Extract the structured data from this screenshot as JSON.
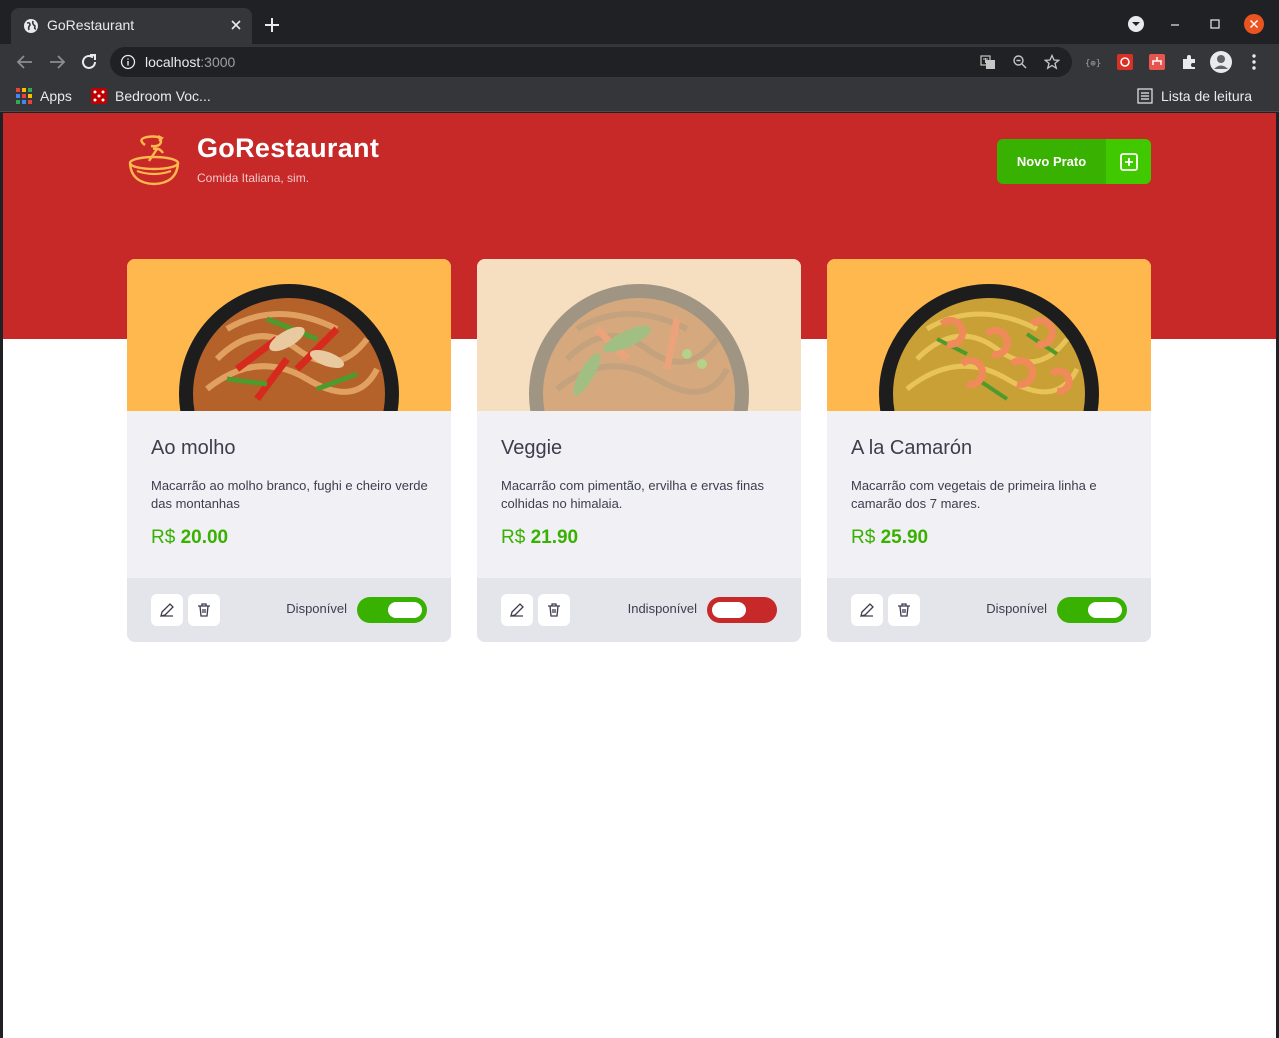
{
  "browser": {
    "tab_title": "GoRestaurant",
    "url_host": "localhost",
    "url_port": ":3000",
    "bookmarks": [
      {
        "label": "Apps",
        "icon": "apps-grid-icon"
      },
      {
        "label": "Bedroom Voc...",
        "icon": "bedroom-voc-icon"
      }
    ],
    "reading_list_label": "Lista de leitura"
  },
  "header": {
    "brand": "GoRestaurant",
    "tagline": "Comida Italiana, sim.",
    "new_button_label": "Novo Prato"
  },
  "colors": {
    "hero": "#c72828",
    "accent_green": "#39b100",
    "unavailable_red": "#c72828"
  },
  "foods": [
    {
      "name": "Ao molho",
      "description": "Macarrão ao molho branco, fughi e cheiro verde das montanhas",
      "currency": "R$",
      "price": "20.00",
      "status_label": "Disponível",
      "available": true
    },
    {
      "name": "Veggie",
      "description": "Macarrão com pimentão, ervilha e ervas finas colhidas no himalaia.",
      "currency": "R$",
      "price": "21.90",
      "status_label": "Indisponível",
      "available": false
    },
    {
      "name": "A la Camarón",
      "description": "Macarrão com vegetais de primeira linha e camarão dos 7 mares.",
      "currency": "R$",
      "price": "25.90",
      "status_label": "Disponível",
      "available": true
    }
  ]
}
